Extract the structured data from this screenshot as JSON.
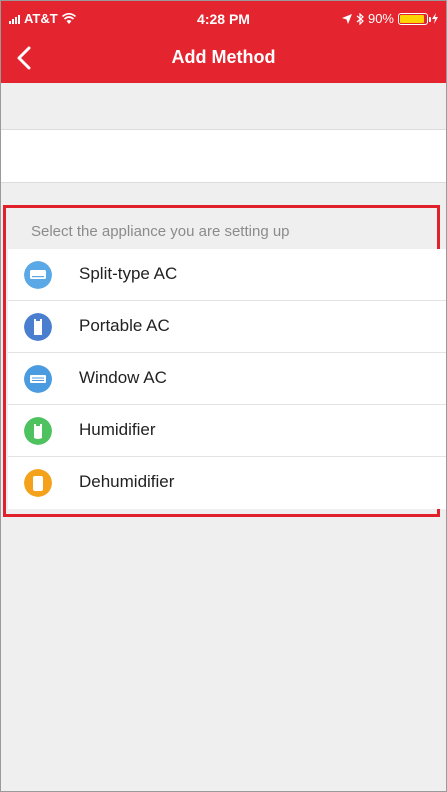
{
  "status_bar": {
    "carrier": "AT&T",
    "time": "4:28 PM",
    "battery": "90%"
  },
  "navbar": {
    "title": "Add Method"
  },
  "section": {
    "title": "Select the appliance you are setting up"
  },
  "appliances": [
    {
      "label": "Split-type AC",
      "icon": "split-ac-icon",
      "color": "#5aa8e6"
    },
    {
      "label": "Portable AC",
      "icon": "portable-ac-icon",
      "color": "#4a7fd0"
    },
    {
      "label": "Window AC",
      "icon": "window-ac-icon",
      "color": "#4a9be0"
    },
    {
      "label": "Humidifier",
      "icon": "humidifier-icon",
      "color": "#4ec25e"
    },
    {
      "label": "Dehumidifier",
      "icon": "dehumidifier-icon",
      "color": "#f4a21b"
    }
  ],
  "colors": {
    "brand": "#e4242e",
    "highlight": "#e0212b"
  }
}
